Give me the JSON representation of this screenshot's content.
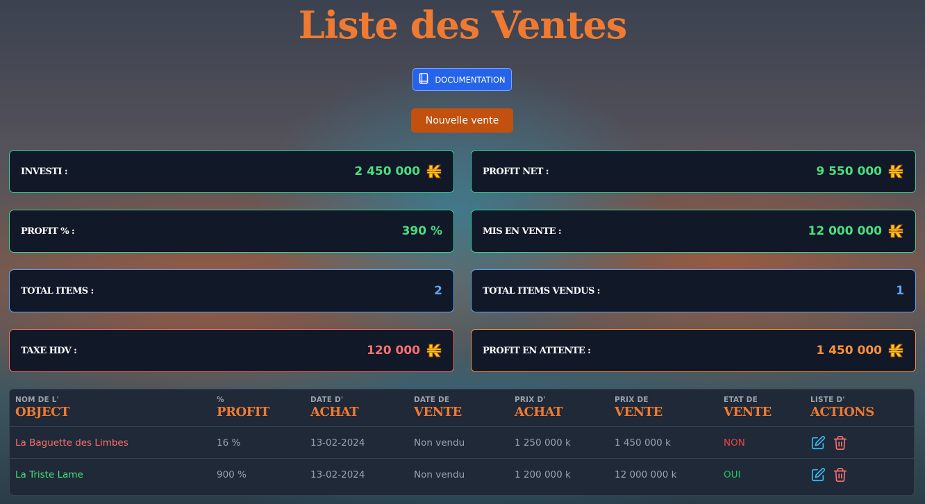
{
  "page_title": "Liste des Ventes",
  "buttons": {
    "documentation": "DOCUMENTATION",
    "new_sale": "Nouvelle vente"
  },
  "stats": {
    "investi": {
      "label": "INVESTI :",
      "value": "2 450 000",
      "icon": "kamas-coin-icon"
    },
    "profit_net": {
      "label": "PROFIT NET :",
      "value": "9 550 000",
      "icon": "kamas-coin-icon"
    },
    "profit_pct": {
      "label": "PROFIT % :",
      "value": "390 %"
    },
    "mis_en_vente": {
      "label": "MIS EN VENTE :",
      "value": "12 000 000",
      "icon": "kamas-coin-icon"
    },
    "total_items": {
      "label": "TOTAL ITEMS :",
      "value": "2"
    },
    "total_items_vendus": {
      "label": "TOTAL ITEMS VENDUS :",
      "value": "1"
    },
    "taxe_hdv": {
      "label": "TAXE HDV :",
      "value": "120 000",
      "icon": "kamas-coin-icon"
    },
    "profit_attente": {
      "label": "PROFIT EN ATTENTE :",
      "value": "1 450 000",
      "icon": "kamas-coin-icon"
    }
  },
  "colors": {
    "green": "#34d399",
    "blue": "#60a5fa",
    "red": "#f87171",
    "orange": "#fb923c",
    "accent": "#f07a32"
  },
  "table": {
    "headers": [
      {
        "small": "NOM DE L'",
        "big": "OBJECT"
      },
      {
        "small": "%",
        "big": "PROFIT"
      },
      {
        "small": "DATE D'",
        "big": "ACHAT"
      },
      {
        "small": "DATE DE",
        "big": "VENTE"
      },
      {
        "small": "PRIX D'",
        "big": "ACHAT"
      },
      {
        "small": "PRIX DE",
        "big": "VENTE"
      },
      {
        "small": "ETAT DE",
        "big": "VENTE"
      },
      {
        "small": "LISTE D'",
        "big": "ACTIONS"
      }
    ],
    "rows": [
      {
        "name": "La Baguette des Limbes",
        "profit": "16 %",
        "date_achat": "13-02-2024",
        "date_vente": "Non vendu",
        "prix_achat": "1 250 000 k",
        "prix_vente": "1 450 000 k",
        "etat": "NON"
      },
      {
        "name": "La Triste Lame",
        "profit": "900 %",
        "date_achat": "13-02-2024",
        "date_vente": "Non vendu",
        "prix_achat": "1 200 000 k",
        "prix_vente": "12 000 000 k",
        "etat": "OUI"
      }
    ]
  }
}
